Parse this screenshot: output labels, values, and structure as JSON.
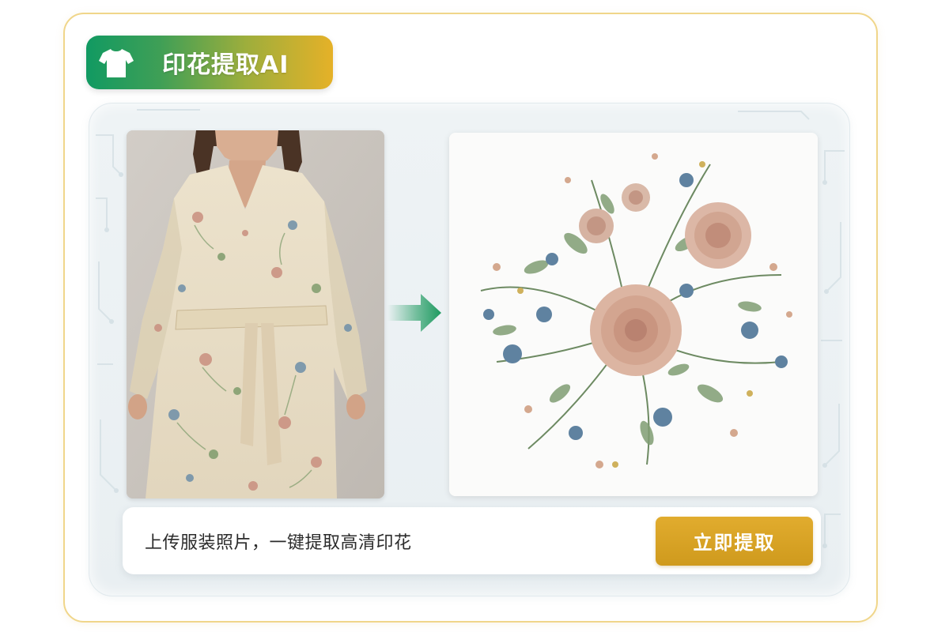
{
  "header": {
    "title": "印花提取AI",
    "icon": "t-shirt-icon"
  },
  "colors": {
    "badge_start": "#119a62",
    "badge_end": "#e5b128",
    "arrow": "#1e9a60",
    "button": "#d8a326",
    "card_border": "#f0d68a"
  },
  "images": {
    "source": "floral-dress-photo",
    "result": "extracted-floral-print"
  },
  "action_bar": {
    "hint": "上传服装照片，一键提取高清印花",
    "button_label": "立即提取"
  }
}
